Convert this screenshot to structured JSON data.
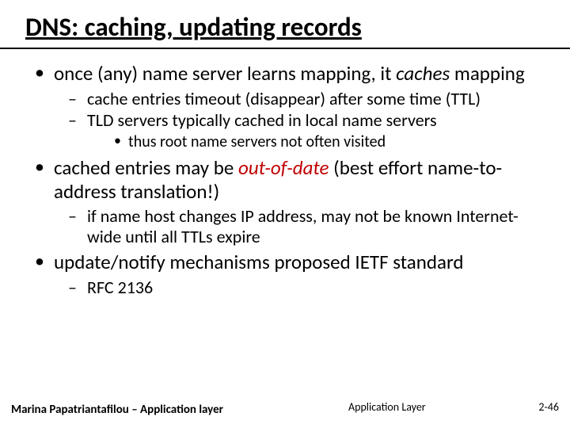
{
  "title": "DNS: caching, updating records",
  "bullets": {
    "b1": {
      "pre": "once (any) name server learns mapping, it ",
      "em": "caches",
      "post": " mapping",
      "sub": {
        "s1": "cache entries timeout (disappear) after some time (TTL)",
        "s2": "TLD servers typically cached in local name servers",
        "subsub": {
          "t1": "thus root name servers not often visited"
        }
      }
    },
    "b2": {
      "pre": "cached entries may be ",
      "em": "out-of-date",
      "post": " (best effort name-to-address translation!)",
      "sub": {
        "s1": "if name host changes IP address, may not be known Internet-wide until all TTLs expire"
      }
    },
    "b3": {
      "text": "update/notify mechanisms proposed IETF standard",
      "sub": {
        "s1": "RFC 2136"
      }
    }
  },
  "footer": {
    "left": "Marina Papatriantafilou –  Application layer",
    "mid": "Application Layer",
    "right": "2-46"
  }
}
